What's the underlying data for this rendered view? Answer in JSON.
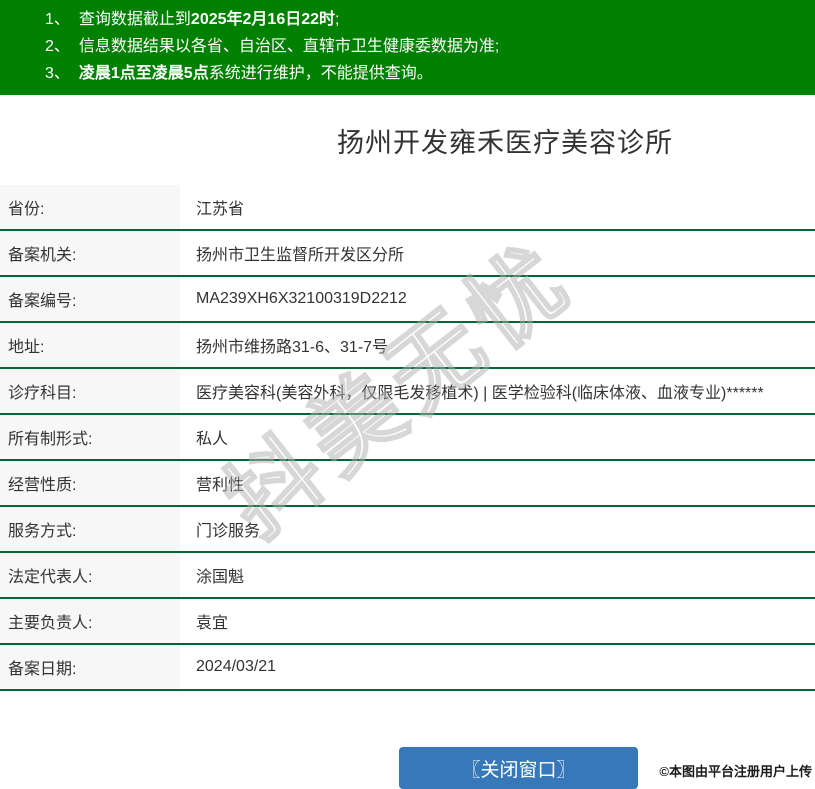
{
  "colors": {
    "header_green": "#008000",
    "separator_green": "#006837",
    "button_blue": "#3779b8",
    "label_cell_bg": "#f7f7f7",
    "text": "#333333"
  },
  "notice": {
    "lines": [
      {
        "num": "1、",
        "segments": [
          {
            "text": "查询数据截止到",
            "bold": false
          },
          {
            "text": "2025年2月16日22时",
            "bold": true
          },
          {
            "text": ";",
            "bold": false
          }
        ]
      },
      {
        "num": "2、",
        "segments": [
          {
            "text": "信息数据结果以各省、自治区、直辖市卫生健康委数据为准;",
            "bold": false
          }
        ]
      },
      {
        "num": "3、",
        "segments": [
          {
            "text": "凌晨1点至凌晨5点",
            "bold": true
          },
          {
            "text": "系统进行维护，不能提供查询。",
            "bold": false
          }
        ]
      }
    ]
  },
  "title": "扬州开发雍禾医疗美容诊所",
  "table": {
    "rows": [
      {
        "label": "省份:",
        "value": "江苏省"
      },
      {
        "label": "备案机关:",
        "value": "扬州市卫生监督所开发区分所"
      },
      {
        "label": "备案编号:",
        "value": "MA239XH6X32100319D2212"
      },
      {
        "label": "地址:",
        "value": "扬州市维扬路31-6、31-7号"
      },
      {
        "label": "诊疗科目:",
        "value": "医疗美容科(美容外科，仅限毛发移植术) | 医学检验科(临床体液、血液专业)******"
      },
      {
        "label": "所有制形式:",
        "value": "私人"
      },
      {
        "label": "经营性质:",
        "value": "营利性"
      },
      {
        "label": "服务方式:",
        "value": "门诊服务"
      },
      {
        "label": "法定代表人:",
        "value": "涂国魁"
      },
      {
        "label": "主要负责人:",
        "value": "袁宜"
      },
      {
        "label": "备案日期:",
        "value": "2024/03/21"
      }
    ]
  },
  "watermark": {
    "text": "抖美无忧"
  },
  "footer": {
    "close_button_label": "〖关闭窗口〗",
    "copyright": "©本图由平台注册用户上传"
  }
}
